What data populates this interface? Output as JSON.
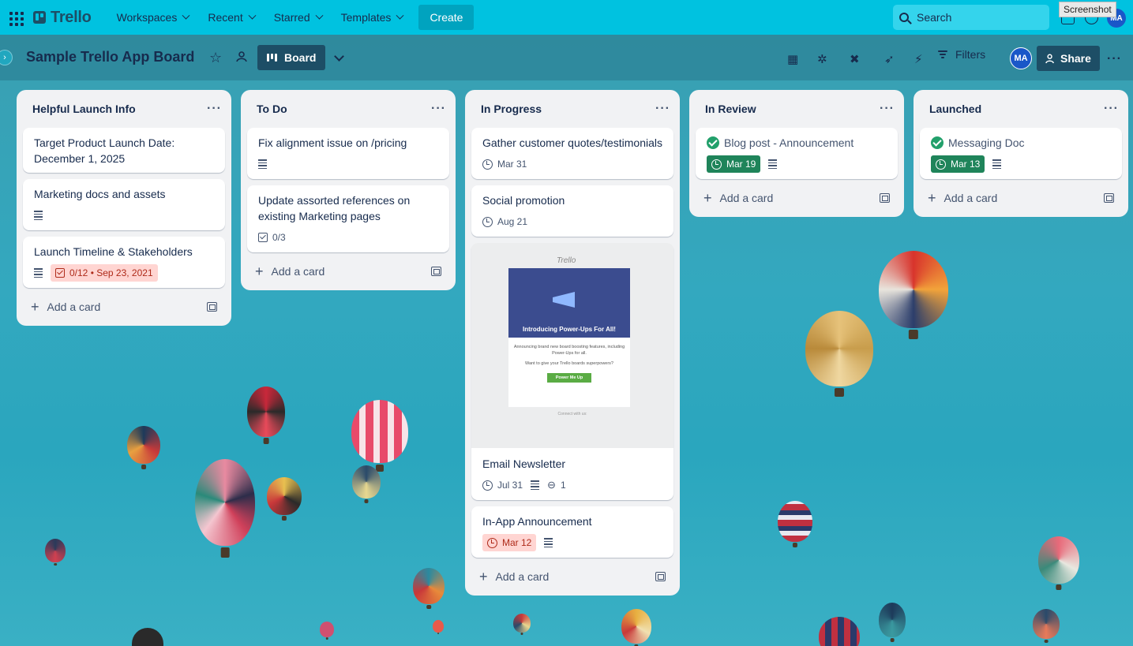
{
  "topnav": {
    "logo_text": "Trello",
    "menus": [
      "Workspaces",
      "Recent",
      "Starred",
      "Templates"
    ],
    "create_label": "Create",
    "search_placeholder": "Search",
    "tooltip": "Screenshot",
    "avatar_initials": "MA"
  },
  "board": {
    "title": "Sample Trello App Board",
    "view_label": "Board",
    "filters_label": "Filters",
    "share_label": "Share",
    "avatar_initials": "MA"
  },
  "lists": [
    {
      "title": "Helpful Launch Info",
      "add_label": "Add a card",
      "cards": [
        {
          "title": "Target Product Launch Date: December 1, 2025"
        },
        {
          "title": "Marketing docs and assets"
        },
        {
          "title": "Launch Timeline & Stakeholders",
          "checklist_date": "0/12 • Sep 23, 2021"
        }
      ]
    },
    {
      "title": "To Do",
      "add_label": "Add a card",
      "cards": [
        {
          "title": "Fix alignment issue on /pricing"
        },
        {
          "title": "Update assorted references on existing Marketing pages",
          "checklist": "0/3"
        }
      ]
    },
    {
      "title": "In Progress",
      "add_label": "Add a card",
      "cards": [
        {
          "title": "Gather customer quotes/testimonials",
          "date": "Mar 31"
        },
        {
          "title": "Social promotion",
          "date": "Aug 21"
        },
        {
          "title": "Email Newsletter",
          "date": "Jul 31",
          "attachments": "1",
          "cover": {
            "logo": "Trello",
            "hero_text": "Introducing Power-Ups For All!",
            "body_1": "Announcing brand new board boosting features, including Power-Ups for all.",
            "body_2": "Want to give your Trello boards superpowers?",
            "button": "Power Me Up",
            "footer": "Connect with us:"
          }
        },
        {
          "title": "In-App Announcement",
          "date": "Mar 12"
        }
      ]
    },
    {
      "title": "In Review",
      "add_label": "Add a card",
      "cards": [
        {
          "title": "Blog post - Announcement",
          "date": "Mar 19"
        }
      ]
    },
    {
      "title": "Launched",
      "add_label": "Add a card",
      "cards": [
        {
          "title": "Messaging Doc",
          "date": "Mar 13"
        }
      ]
    }
  ]
}
